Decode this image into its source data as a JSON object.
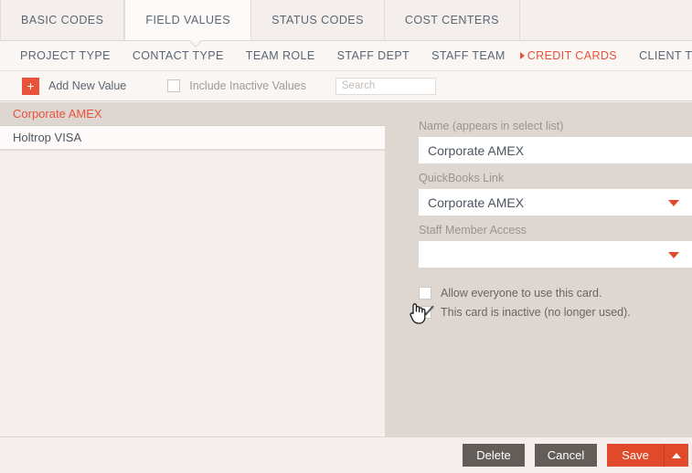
{
  "main_tabs": [
    {
      "label": "BASIC CODES",
      "active": false
    },
    {
      "label": "FIELD VALUES",
      "active": true
    },
    {
      "label": "STATUS CODES",
      "active": false
    },
    {
      "label": "COST CENTERS",
      "active": false
    }
  ],
  "sub_tabs": [
    {
      "label": "PROJECT TYPE",
      "active": false
    },
    {
      "label": "CONTACT TYPE",
      "active": false
    },
    {
      "label": "TEAM ROLE",
      "active": false
    },
    {
      "label": "STAFF DEPT",
      "active": false
    },
    {
      "label": "STAFF TEAM",
      "active": false
    },
    {
      "label": "CREDIT CARDS",
      "active": true
    },
    {
      "label": "CLIENT TYPE",
      "active": false
    }
  ],
  "toolbar": {
    "add_icon": "plus-icon",
    "add_label": "Add New Value",
    "include_inactive_label": "Include Inactive Values",
    "include_inactive_checked": false,
    "search_placeholder": "Search",
    "search_value": ""
  },
  "list": {
    "items": [
      {
        "label": "Corporate AMEX",
        "selected": true
      },
      {
        "label": "Holtrop VISA",
        "selected": false
      }
    ]
  },
  "detail": {
    "name_label": "Name (appears in select list)",
    "name_value": "Corporate AMEX",
    "quickbooks_label": "QuickBooks Link",
    "quickbooks_value": "Corporate AMEX",
    "staff_access_label": "Staff Member Access",
    "staff_access_value": "",
    "allow_everyone_label": "Allow everyone to use this card.",
    "allow_everyone_checked": false,
    "inactive_label": "This card is inactive (no longer used).",
    "inactive_checked": true
  },
  "footer": {
    "delete_label": "Delete",
    "cancel_label": "Cancel",
    "save_label": "Save",
    "save_caret_icon": "caret-up-icon"
  },
  "colors": {
    "accent": "#e8523a",
    "panel": "#ded6d1",
    "page": "#f4efec",
    "button_gray": "#625d58",
    "save_orange": "#e04a2b"
  }
}
